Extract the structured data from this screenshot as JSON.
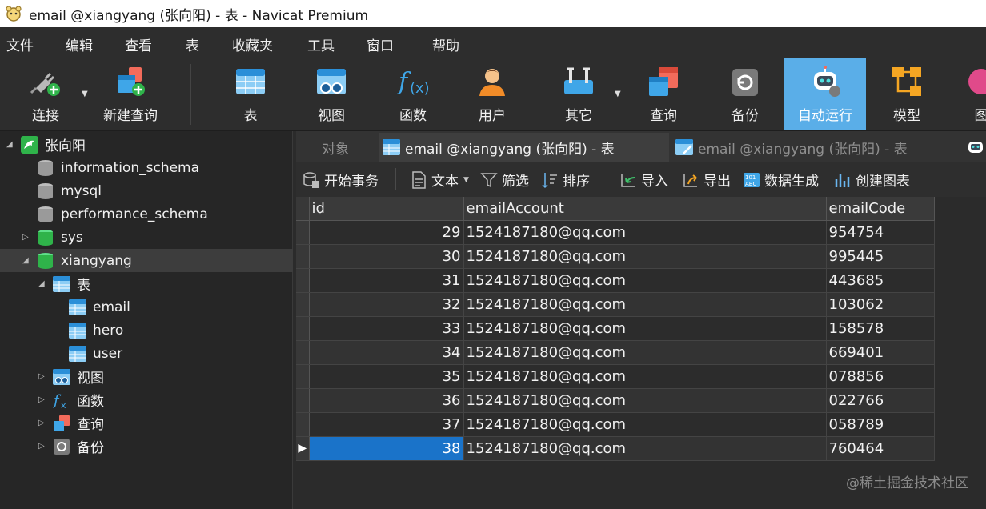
{
  "window": {
    "title": "email @xiangyang (张向阳) - 表 - Navicat Premium"
  },
  "menu": [
    "文件",
    "编辑",
    "查看",
    "表",
    "收藏夹",
    "工具",
    "窗口",
    "帮助"
  ],
  "toolbar": {
    "connect": "连接",
    "new_query": "新建查询",
    "table": "表",
    "view": "视图",
    "function": "函数",
    "user": "用户",
    "other": "其它",
    "query": "查询",
    "backup": "备份",
    "auto_run": "自动运行",
    "model": "模型",
    "chart_partial": "图"
  },
  "sidebar": {
    "connection": "张向阳",
    "databases": [
      "information_schema",
      "mysql",
      "performance_schema",
      "sys",
      "xiangyang"
    ],
    "tables_group": "表",
    "tables": [
      "email",
      "hero",
      "user"
    ],
    "groups": [
      "视图",
      "函数",
      "查询",
      "备份"
    ]
  },
  "tabs": {
    "objects": "对象",
    "active": "email @xiangyang (张向阳) - 表",
    "inactive": "email @xiangyang (张向阳) - 表"
  },
  "subbar": {
    "begin_tx": "开始事务",
    "text": "文本",
    "filter": "筛选",
    "sort": "排序",
    "import": "导入",
    "export": "导出",
    "data_gen": "数据生成",
    "create_chart": "创建图表"
  },
  "grid": {
    "columns": [
      "id",
      "emailAccount",
      "emailCode"
    ],
    "rows": [
      [
        "29",
        "1524187180@qq.com",
        "954754"
      ],
      [
        "30",
        "1524187180@qq.com",
        "995445"
      ],
      [
        "31",
        "1524187180@qq.com",
        "443685"
      ],
      [
        "32",
        "1524187180@qq.com",
        "103062"
      ],
      [
        "33",
        "1524187180@qq.com",
        "158578"
      ],
      [
        "34",
        "1524187180@qq.com",
        "669401"
      ],
      [
        "35",
        "1524187180@qq.com",
        "078856"
      ],
      [
        "36",
        "1524187180@qq.com",
        "022766"
      ],
      [
        "37",
        "1524187180@qq.com",
        "058789"
      ],
      [
        "38",
        "1524187180@qq.com",
        "760464"
      ]
    ]
  },
  "watermark": "@稀土掘金技术社区",
  "colors": {
    "accent": "#5aaee8",
    "selection": "#1a73c9"
  }
}
